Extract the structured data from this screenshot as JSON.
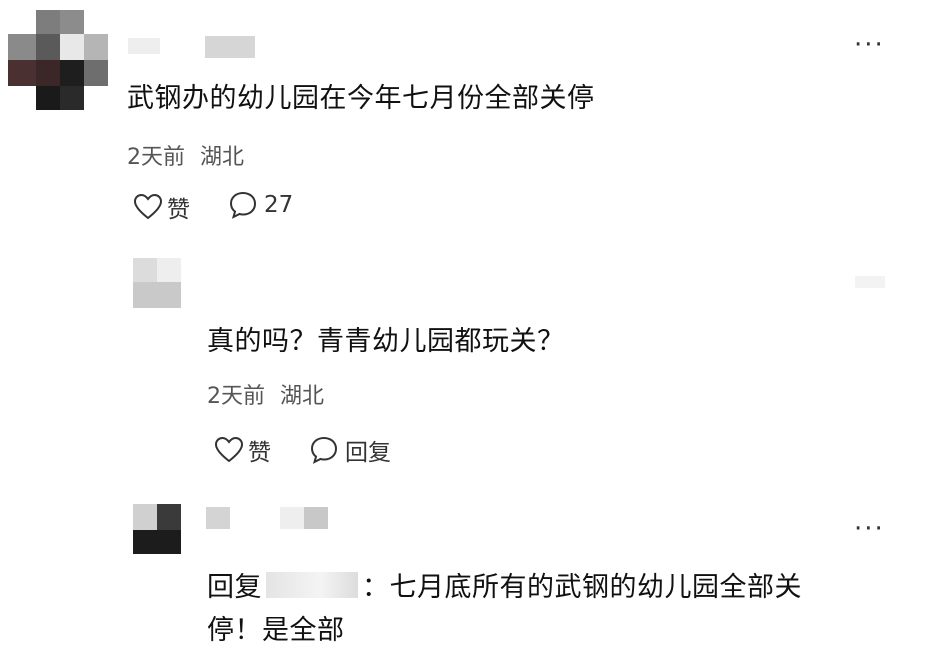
{
  "comments": [
    {
      "text": "武钢办的幼儿园在今年七月份全部关停",
      "time": "2天前",
      "location": "湖北",
      "like_label": "赞",
      "reply_count": "27",
      "more_label": "···"
    },
    {
      "text": "真的吗？青青幼儿园都玩关？",
      "time": "2天前",
      "location": "湖北",
      "like_label": "赞",
      "reply_label": "回复"
    },
    {
      "reply_prefix": "回复",
      "line1": "：七月底所有的武钢的幼儿园全部关",
      "line2": "停！是全部",
      "more_label": "···"
    }
  ]
}
